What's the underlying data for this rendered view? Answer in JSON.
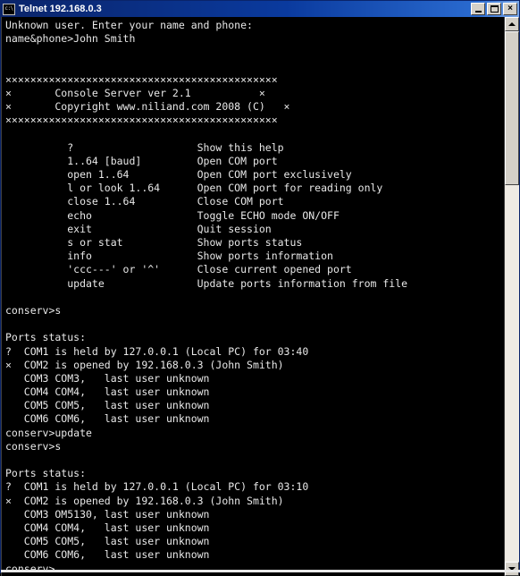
{
  "window": {
    "title": "Telnet 192.168.0.3",
    "icon_name": "telnet-app-icon",
    "icon_glyph": "c:\\",
    "buttons": {
      "minimize_label": "_",
      "maximize_label": "□",
      "close_label": "×"
    }
  },
  "scrollbar": {
    "up_arrow_label": "▲",
    "down_arrow_label": "▼"
  },
  "console": {
    "lines": [
      "Unknown user. Enter your name and phone:",
      "name&phone>John Smith",
      "",
      "",
      "××××××××××××××××××××××××××××××××××××××××××××",
      "×       Console Server ver 2.1           ×",
      "×       Copyright www.niliand.com 2008 (C)   ×",
      "××××××××××××××××××××××××××××××××××××××××××××",
      "",
      "          ?                    Show this help",
      "          1..64 [baud]         Open COM port",
      "          open 1..64           Open COM port exclusively",
      "          l or look 1..64      Open COM port for reading only",
      "          close 1..64          Close COM port",
      "          echo                 Toggle ECHO mode ON/OFF",
      "          exit                 Quit session",
      "          s or stat            Show ports status",
      "          info                 Show ports information",
      "          'ccc---' or '^'      Close current opened port",
      "          update               Update ports information from file",
      "",
      "conserv>s",
      "",
      "Ports status:",
      "?  COM1 is held by 127.0.0.1 (Local PC) for 03:40",
      "×  COM2 is opened by 192.168.0.3 (John Smith)",
      "   COM3 COM3,   last user unknown",
      "   COM4 COM4,   last user unknown",
      "   COM5 COM5,   last user unknown",
      "   COM6 COM6,   last user unknown",
      "conserv>update",
      "conserv>s",
      "",
      "Ports status:",
      "?  COM1 is held by 127.0.0.1 (Local PC) for 03:10",
      "×  COM2 is opened by 192.168.0.3 (John Smith)",
      "   COM3 OM5130, last user unknown",
      "   COM4 COM4,   last user unknown",
      "   COM5 COM5,   last user unknown",
      "   COM6 COM6,   last user unknown",
      "conserv>"
    ]
  },
  "colors": {
    "title_bar_start": "#0a246a",
    "title_bar_end": "#7aa7e8",
    "console_bg": "#000000",
    "console_fg": "#e8e8e8",
    "chrome": "#d4d0c8"
  }
}
